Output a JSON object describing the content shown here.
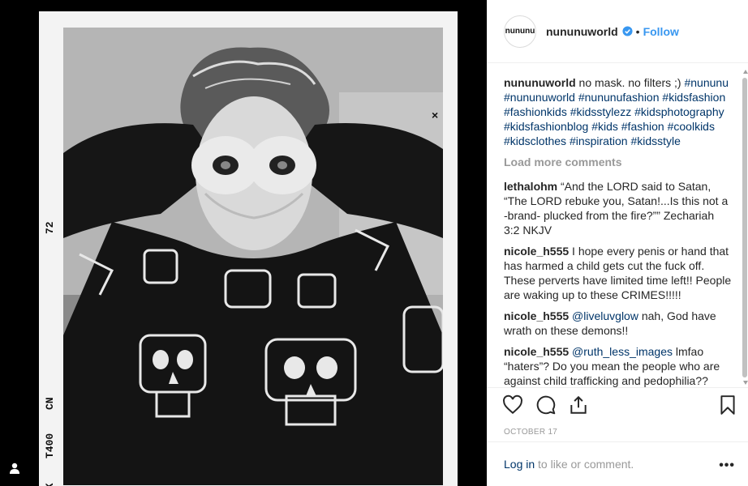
{
  "film_edge": {
    "code_72": "72",
    "code_cn": "CN",
    "code_t400": "T400",
    "code_ak": "AK",
    "mark_x": "×"
  },
  "post": {
    "username": "nununuworld",
    "avatar_text": "nununu",
    "follow_label": "Follow",
    "separator": "•",
    "caption": {
      "user": "nununuworld",
      "text": " no mask. no filters ;)",
      "hashtags": [
        "#nununu",
        "#nununuworld",
        "#nununufashion",
        "#kidsfashion",
        "#fashionkids",
        "#kidsstylezz",
        "#kidsphotography",
        "#kidsfashionblog",
        "#kids",
        "#fashion",
        "#coolkids",
        "#kidsclothes",
        "#inspiration",
        "#kidsstyle"
      ]
    },
    "load_more": "Load more comments",
    "comments": [
      {
        "user": "lethalohm",
        "text": " “And the LORD said to Satan, “The LORD rebuke you, Satan!...Is this not a -brand- plucked from the fire?”” Zechariah 3:2 NKJV"
      },
      {
        "user": "nicole_h555",
        "text": " I hope every penis or hand that has harmed a child gets cut the fuck off. These perverts have limited time left!! People are waking up to these CRIMES!!!!!"
      },
      {
        "user": "nicole_h555",
        "mention": "@liveluvglow",
        "text": " nah, God have wrath on these demons!!"
      },
      {
        "user": "nicole_h555",
        "mention": "@ruth_less_images",
        "text": " lmfao “haters”? Do you mean the people who are against child trafficking and pedophilia??"
      }
    ],
    "date": "OCTOBER 17",
    "login_link": "Log in",
    "login_text": " to like or comment.",
    "more_options": "•••"
  },
  "icons": {
    "verified": "verified-badge-icon",
    "like": "heart-icon",
    "comment": "comment-bubble-icon",
    "share": "share-icon",
    "save": "bookmark-icon",
    "tag": "user-tag-icon"
  },
  "colors": {
    "link": "#3897f0",
    "hashtag": "#003569",
    "muted": "#999999"
  }
}
